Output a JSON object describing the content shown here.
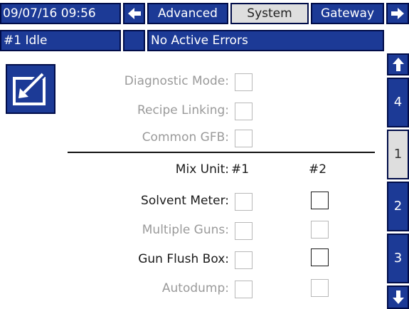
{
  "header": {
    "datetime": "09/07/16 09:56",
    "tabs": [
      {
        "label": "Advanced",
        "active": false
      },
      {
        "label": "System",
        "active": true
      },
      {
        "label": "Gateway",
        "active": false
      }
    ]
  },
  "status": {
    "unit": "#1 Idle",
    "blank": "",
    "message": "No Active Errors"
  },
  "sidebar": {
    "items": [
      {
        "label": "4",
        "active": false
      },
      {
        "label": "1",
        "active": true
      },
      {
        "label": "2",
        "active": false
      },
      {
        "label": "3",
        "active": false
      }
    ]
  },
  "settings": {
    "diagnostic_mode": "Diagnostic Mode:",
    "recipe_linking": "Recipe Linking:",
    "common_gfb": "Common GFB:"
  },
  "mix_units": {
    "label": "Mix Unit:",
    "col1": "#1",
    "col2": "#2",
    "rows": [
      {
        "label": "Solvent Meter:",
        "enabled": true
      },
      {
        "label": "Multiple Guns:",
        "enabled": false
      },
      {
        "label": "Gun Flush Box:",
        "enabled": true
      },
      {
        "label": "Autodump:",
        "enabled": false
      }
    ]
  },
  "colors": {
    "accent": "#1c3a96",
    "border": "#000c48",
    "active_tab": "#dedede",
    "disabled_text": "#9a9a9a"
  },
  "icons": {
    "edit": "edit-icon",
    "arrow_left": "arrow-left-icon",
    "arrow_right": "arrow-right-icon",
    "arrow_up": "arrow-up-icon",
    "arrow_down": "arrow-down-icon"
  }
}
